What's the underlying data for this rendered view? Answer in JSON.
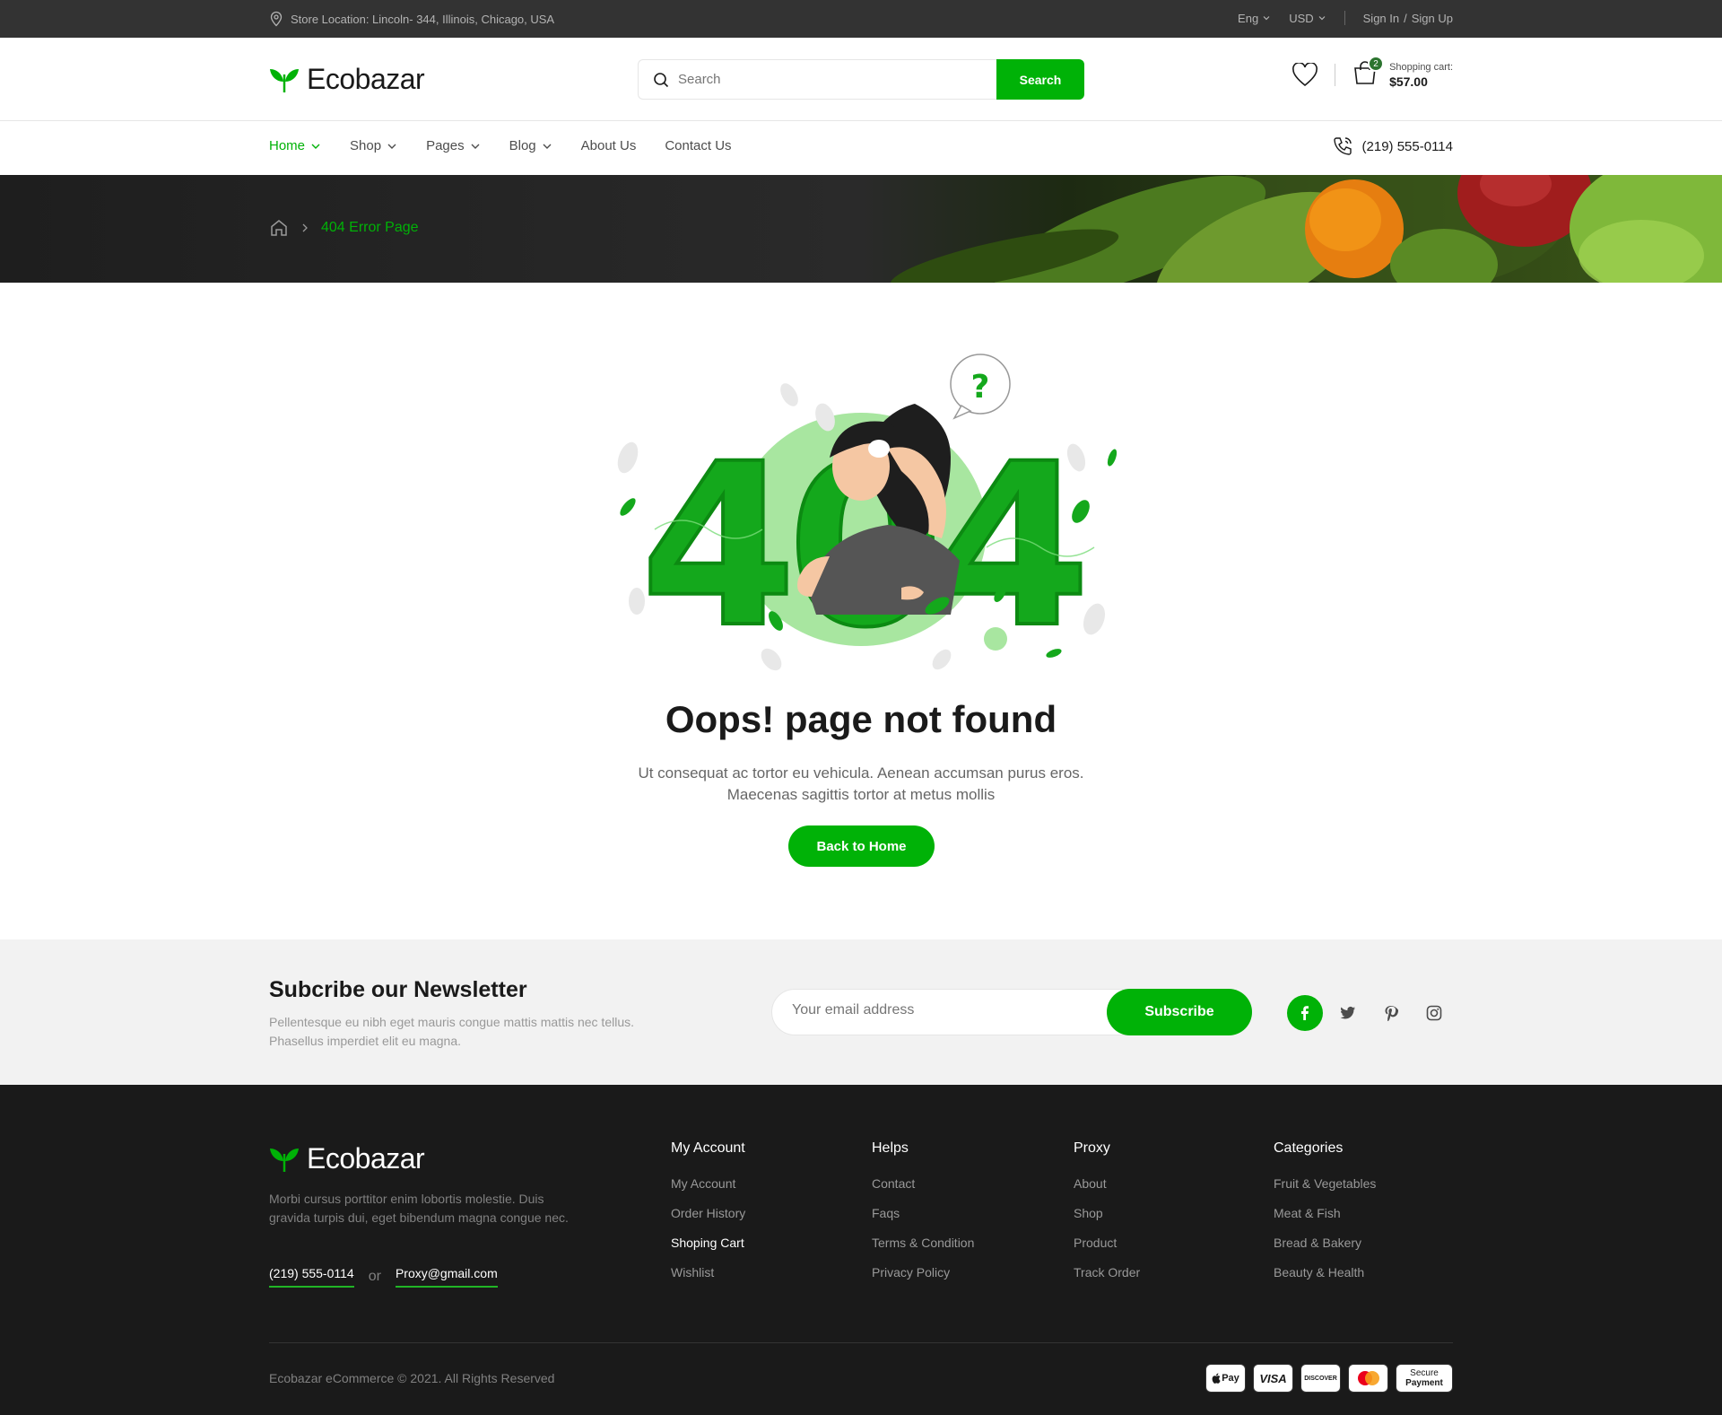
{
  "topbar": {
    "location": "Store Location: Lincoln- 344, Illinois, Chicago, USA",
    "language": "Eng",
    "currency": "USD",
    "sign_in": "Sign In",
    "divider": "/",
    "sign_up": "Sign Up"
  },
  "header": {
    "brand": "Ecobazar",
    "search_placeholder": "Search",
    "search_button": "Search",
    "cart_count": "2",
    "cart_label": "Shopping cart:",
    "cart_total": "$57.00"
  },
  "nav": {
    "items": [
      {
        "label": "Home"
      },
      {
        "label": "Shop"
      },
      {
        "label": "Pages"
      },
      {
        "label": "Blog"
      },
      {
        "label": "About Us"
      },
      {
        "label": "Contact Us"
      }
    ],
    "phone": "(219) 555-0114"
  },
  "breadcrumb": {
    "current": "404 Error Page"
  },
  "error": {
    "illustration_text": "404",
    "title": "Oops! page not found",
    "description_line1": "Ut consequat ac tortor eu vehicula. Aenean accumsan purus eros.",
    "description_line2": "Maecenas sagittis tortor at metus mollis",
    "button": "Back to Home"
  },
  "newsletter": {
    "title": "Subcribe our Newsletter",
    "description": "Pellentesque eu nibh eget mauris congue mattis mattis nec tellus. Phasellus imperdiet elit eu magna.",
    "email_placeholder": "Your email address",
    "button": "Subscribe",
    "socials": [
      "facebook-icon",
      "twitter-icon",
      "pinterest-icon",
      "instagram-icon"
    ]
  },
  "footer": {
    "brand": "Ecobazar",
    "about": "Morbi cursus porttitor enim lobortis molestie. Duis gravida turpis dui, eget bibendum magna congue nec.",
    "phone": "(219) 555-0114",
    "or": "or",
    "email": "Proxy@gmail.com",
    "columns": [
      {
        "title": "My Account",
        "links": [
          "My Account",
          "Order History",
          "Shoping Cart",
          "Wishlist"
        ]
      },
      {
        "title": "Helps",
        "links": [
          "Contact",
          "Faqs",
          "Terms & Condition",
          "Privacy Policy"
        ]
      },
      {
        "title": "Proxy",
        "links": [
          "About",
          "Shop",
          "Product",
          "Track Order"
        ]
      },
      {
        "title": "Categories",
        "links": [
          "Fruit & Vegetables",
          "Meat & Fish",
          "Bread & Bakery",
          "Beauty & Health"
        ]
      }
    ],
    "copyright": "Ecobazar eCommerce © 2021. All Rights Reserved",
    "payments": {
      "apple_pay": "Pay",
      "visa": "VISA",
      "discover": "DISCOVER",
      "secure_line1": "Secure",
      "secure_line2": "Payment"
    }
  },
  "colors": {
    "brand_green": "#00b207",
    "dark": "#1a1a1a",
    "topbar": "#333333"
  }
}
